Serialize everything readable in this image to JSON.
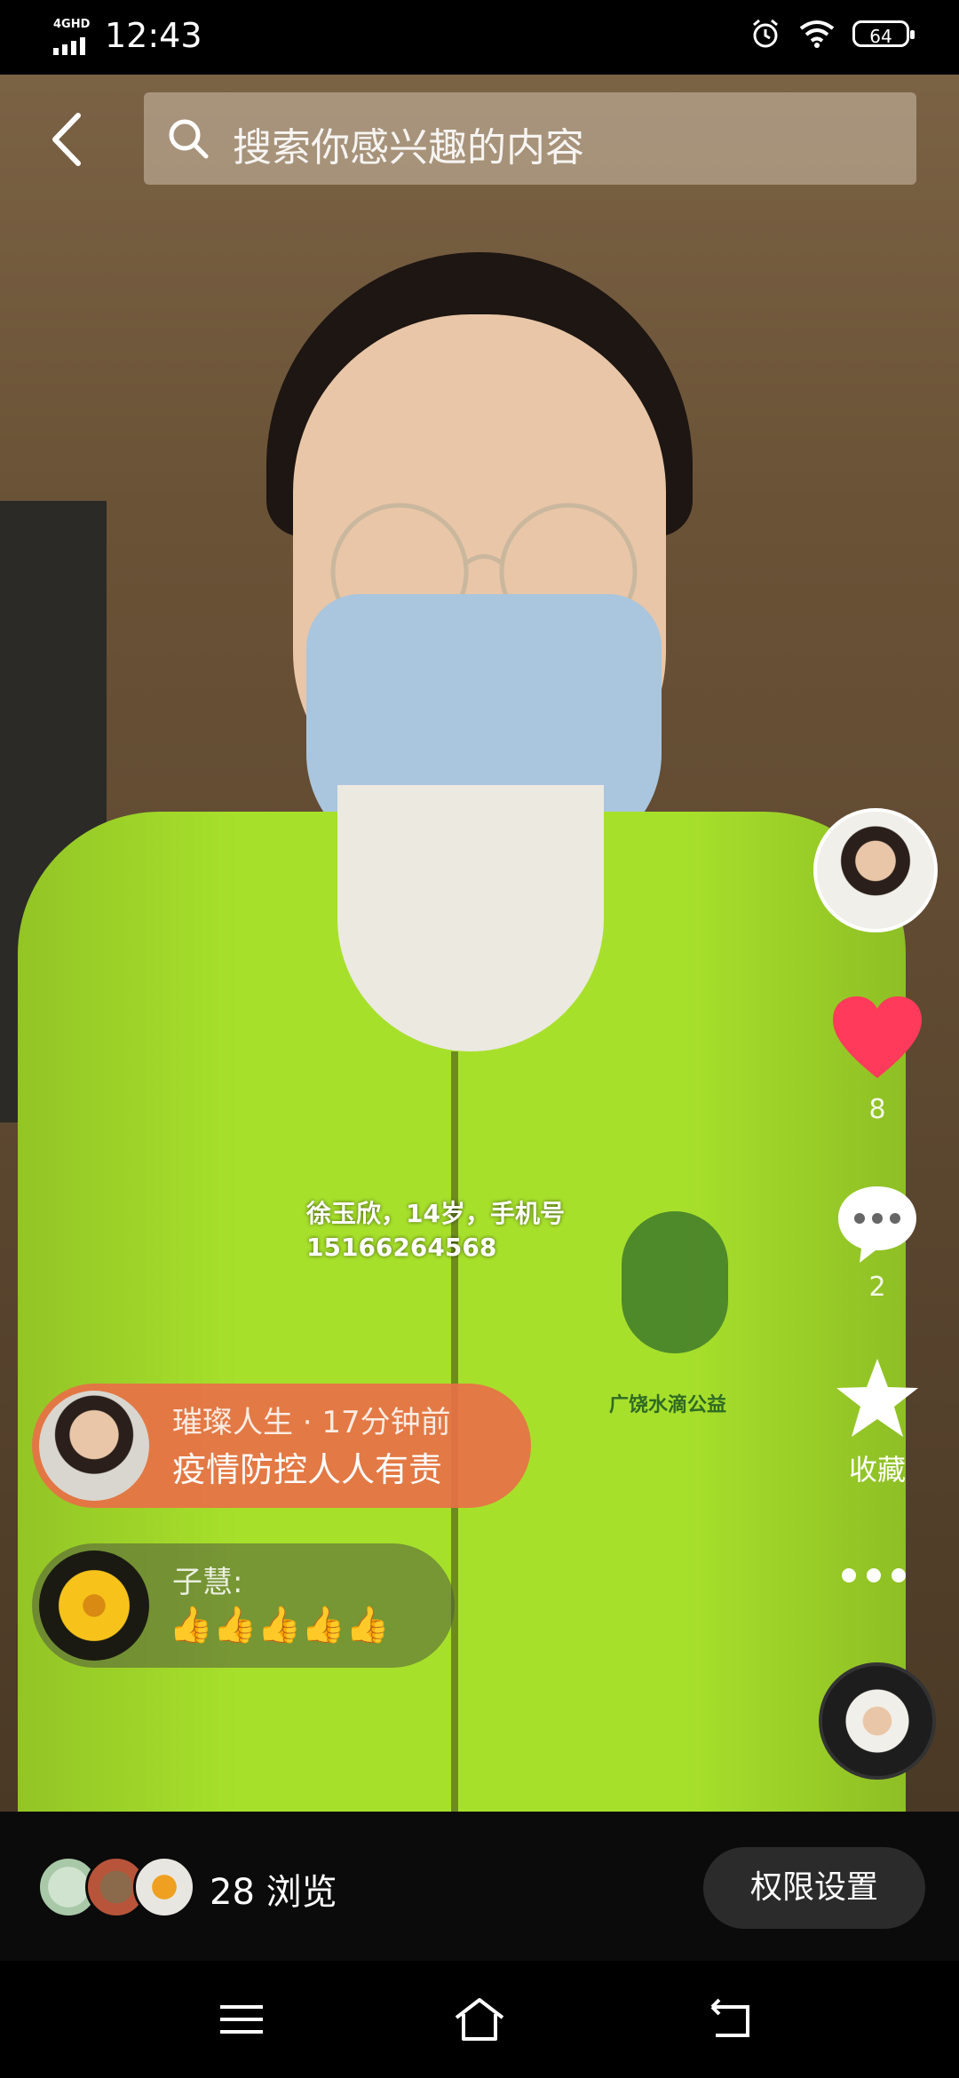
{
  "status_bar": {
    "network": "4GHD",
    "time": "12:43",
    "battery": "64"
  },
  "search": {
    "placeholder": "搜索你感兴趣的内容"
  },
  "photo": {
    "overlay_line1": "徐玉欣，14岁，手机号",
    "overlay_line2": "15166264568",
    "vest_logo_text": "广饶水滴公益"
  },
  "comments": [
    {
      "user": "璀璨人生 · 17分钟前",
      "text": "疫情防控人人有责"
    },
    {
      "user": "子慧:",
      "text": "👍👍👍👍👍"
    }
  ],
  "rail": {
    "like_count": "8",
    "comment_count": "2",
    "favorite_label": "收藏"
  },
  "bottom": {
    "views": "28 浏览",
    "permission_button": "权限设置"
  },
  "colors": {
    "like": "#ff3a5a",
    "hot_comment_bg": "#e87046",
    "vest": "#a7e02b"
  }
}
